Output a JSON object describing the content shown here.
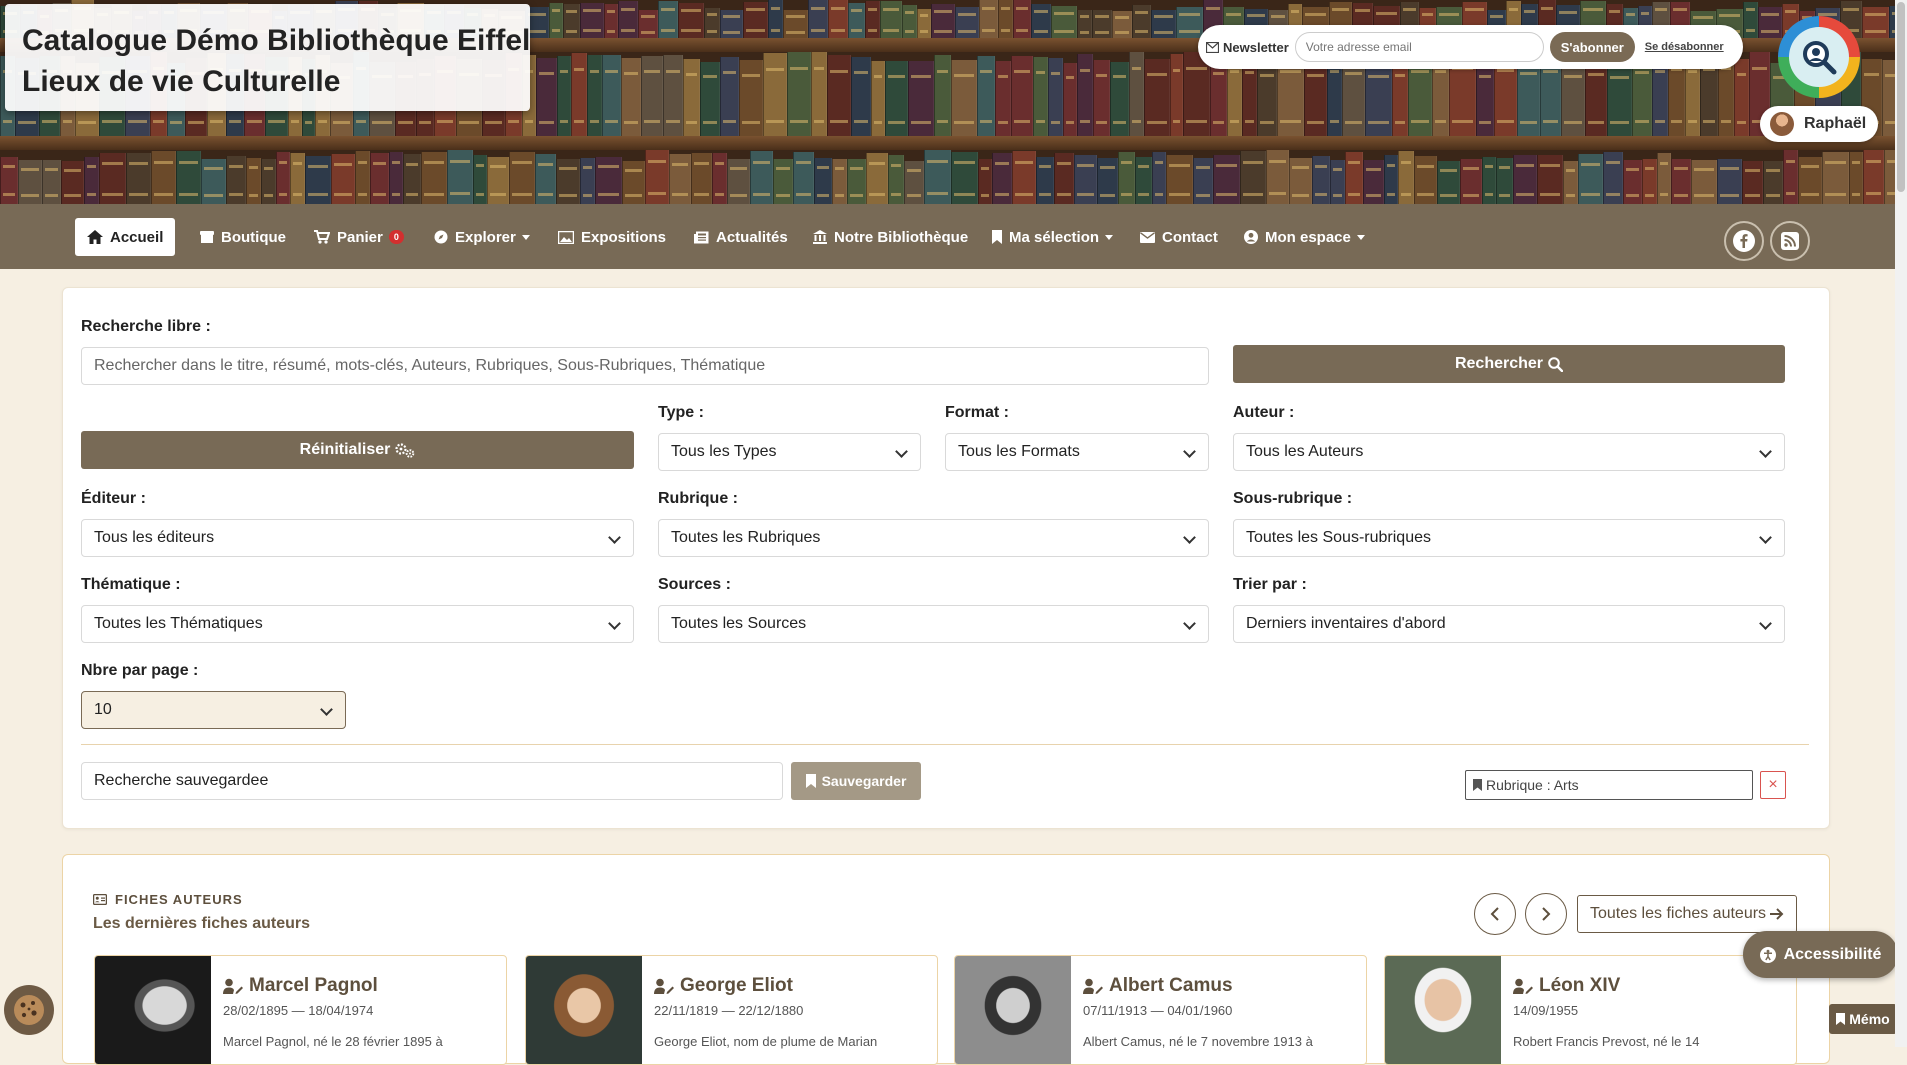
{
  "header": {
    "title_line1": "Catalogue Démo Bibliothèque Eiffel",
    "title_line2": "Lieux de vie Culturelle",
    "newsletter": {
      "label": "Newsletter",
      "placeholder": "Votre adresse email",
      "subscribe_label": "S'abonner",
      "unsubscribe_label": "Se désabonner"
    },
    "logo_icon": "magnifier-logo-icon",
    "user_name": "Raphaël"
  },
  "nav": {
    "items": [
      {
        "label": "Accueil",
        "icon": "home-icon"
      },
      {
        "label": "Boutique",
        "icon": "shop-icon"
      },
      {
        "label": "Panier",
        "icon": "cart-icon",
        "badge": "0"
      },
      {
        "label": "Explorer",
        "icon": "compass-icon"
      },
      {
        "label": "Expositions",
        "icon": "image-icon"
      },
      {
        "label": "Actualités",
        "icon": "newspaper-icon"
      },
      {
        "label": "Notre Bibliothèque",
        "icon": "bank-icon"
      },
      {
        "label": "Ma sélection",
        "icon": "bookmark-icon"
      },
      {
        "label": "Contact",
        "icon": "envelope-icon"
      },
      {
        "label": "Mon espace",
        "icon": "user-circle-icon"
      }
    ],
    "social": [
      "facebook-icon",
      "rss-icon"
    ]
  },
  "search": {
    "free_label": "Recherche libre :",
    "free_placeholder": "Rechercher dans le titre, résumé, mots-clés, Auteurs, Rubriques, Sous-Rubriques, Thématique",
    "search_button": "Rechercher",
    "reset_button": "Réinitialiser",
    "type_label": "Type :",
    "type_value": "Tous les Types",
    "format_label": "Format :",
    "format_value": "Tous les Formats",
    "author_label": "Auteur :",
    "author_value": "Tous les Auteurs",
    "publisher_label": "Éditeur :",
    "publisher_value": "Tous les éditeurs",
    "rubric_label": "Rubrique :",
    "rubric_value": "Toutes les Rubriques",
    "subrubric_label": "Sous-rubrique :",
    "subrubric_value": "Toutes les Sous-rubriques",
    "theme_label": "Thématique :",
    "theme_value": "Toutes les Thématiques",
    "sources_label": "Sources :",
    "sources_value": "Toutes les Sources",
    "sort_label": "Trier par :",
    "sort_value": "Derniers inventaires d'abord",
    "perpage_label": "Nbre par page :",
    "perpage_value": "10",
    "saved_search_value": "Recherche sauvegardee",
    "save_button": "Sauvegarder",
    "active_filter": "Rubrique : Arts",
    "remove_filter": "×"
  },
  "authors": {
    "kicker": "FICHES AUTEURS",
    "title": "Les dernières fiches auteurs",
    "all_button": "Toutes les fiches auteurs",
    "cards": [
      {
        "name": "Marcel Pagnol",
        "dates": "28/02/1895 — 18/04/1974",
        "desc": "Marcel Pagnol, né le 28 février 1895 à"
      },
      {
        "name": "George Eliot",
        "dates": "22/11/1819 — 22/12/1880",
        "desc": "George Eliot, nom de plume de Marian"
      },
      {
        "name": "Albert Camus",
        "dates": "07/11/1913 — 04/01/1960",
        "desc": "Albert Camus, né le 7 novembre 1913 à"
      },
      {
        "name": "Léon XIV",
        "dates": "14/09/1955",
        "desc": "Robert Francis Prevost, né le 14"
      }
    ]
  },
  "floating": {
    "accessibility": "Accessibilité",
    "memo": "Mémo",
    "cookie_icon": "cookie-icon"
  }
}
